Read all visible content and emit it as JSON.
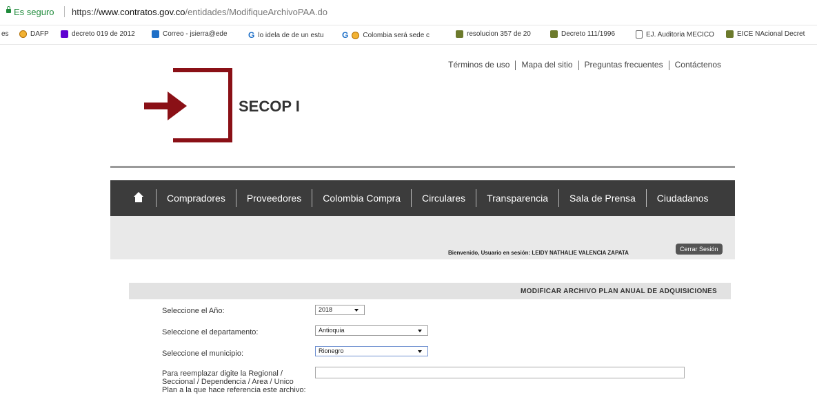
{
  "address_bar": {
    "secure_label": "Es seguro",
    "url_scheme": "https://",
    "url_host": "www.contratos.gov.co",
    "url_path": "/entidades/ModifiqueArchivoPAA.do"
  },
  "bookmarks": [
    {
      "label": "es",
      "icon": "none"
    },
    {
      "label": "DAFP",
      "icon": "seal-icon"
    },
    {
      "label": "decreto 019 de 2012",
      "icon": "yahoo-icon"
    },
    {
      "label": "Correo - jsierra@ede",
      "icon": "outlook-icon"
    },
    {
      "label": "lo idela de de un estu",
      "icon": "google-icon"
    },
    {
      "label": "Colombia será sede c",
      "icon": "google-icon"
    },
    {
      "label": "resolucion 357 de 20",
      "icon": "flag-icon"
    },
    {
      "label": "Decreto 111/1996",
      "icon": "flag-icon"
    },
    {
      "label": "EJ. Auditoria MECICO",
      "icon": "document-icon"
    },
    {
      "label": "EICE NAcional Decret",
      "icon": "flag-icon"
    }
  ],
  "header": {
    "links": [
      "Términos de uso",
      "Mapa del sitio",
      "Preguntas frecuentes",
      "Contáctenos"
    ],
    "brand": "SECOP I"
  },
  "nav": {
    "items": [
      "Compradores",
      "Proveedores",
      "Colombia Compra",
      "Circulares",
      "Transparencia",
      "Sala de Prensa",
      "Ciudadanos"
    ]
  },
  "session": {
    "welcome": "Bienvenido, Usuario en sesión: LEIDY NATHALIE VALENCIA ZAPATA",
    "logout": "Cerrar Sesión"
  },
  "form": {
    "title": "MODIFICAR ARCHIVO PLAN ANUAL DE ADQUISICIONES",
    "year_label": "Seleccione el Año:",
    "year_value": "2018",
    "dept_label": "Seleccione el departamento:",
    "dept_value": "Antioquia",
    "muni_label": "Seleccione el municipio:",
    "muni_value": "Rionegro",
    "regional_label": "Para reemplazar digite la Regional / Seccional / Dependencia / Area / Unico Plan a la que hace referencia este archivo:",
    "regional_value": ""
  },
  "colors": {
    "brand_red": "#8a1016",
    "nav_bg": "#3c3c3c",
    "secure_green": "#1e8a3a"
  }
}
